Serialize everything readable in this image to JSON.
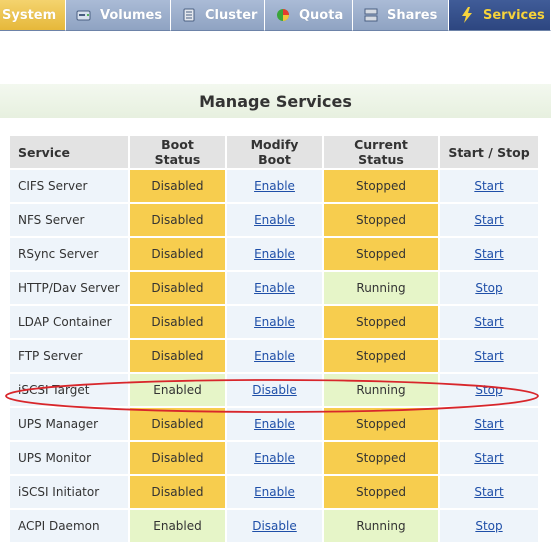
{
  "tabs": [
    {
      "label": "System",
      "icon": "system-icon"
    },
    {
      "label": "Volumes",
      "icon": "volumes-icon"
    },
    {
      "label": "Cluster",
      "icon": "cluster-icon"
    },
    {
      "label": "Quota",
      "icon": "quota-icon"
    },
    {
      "label": "Shares",
      "icon": "shares-icon"
    },
    {
      "label": "Services",
      "icon": "lightning-icon",
      "active": true
    }
  ],
  "page_title": "Manage Services",
  "table": {
    "headers": [
      "Service",
      "Boot Status",
      "Modify Boot",
      "Current Status",
      "Start / Stop"
    ],
    "rows": [
      {
        "service": "CIFS Server",
        "boot_status": "Disabled",
        "modify": "Enable",
        "current": "Stopped",
        "action": "Start"
      },
      {
        "service": "NFS Server",
        "boot_status": "Disabled",
        "modify": "Enable",
        "current": "Stopped",
        "action": "Start"
      },
      {
        "service": "RSync Server",
        "boot_status": "Disabled",
        "modify": "Enable",
        "current": "Stopped",
        "action": "Start"
      },
      {
        "service": "HTTP/Dav Server",
        "boot_status": "Disabled",
        "modify": "Enable",
        "current": "Running",
        "action": "Stop"
      },
      {
        "service": "LDAP Container",
        "boot_status": "Disabled",
        "modify": "Enable",
        "current": "Stopped",
        "action": "Start"
      },
      {
        "service": "FTP Server",
        "boot_status": "Disabled",
        "modify": "Enable",
        "current": "Stopped",
        "action": "Start"
      },
      {
        "service": "iSCSI Target",
        "boot_status": "Enabled",
        "modify": "Disable",
        "current": "Running",
        "action": "Stop",
        "highlighted": true
      },
      {
        "service": "UPS Manager",
        "boot_status": "Disabled",
        "modify": "Enable",
        "current": "Stopped",
        "action": "Start"
      },
      {
        "service": "UPS Monitor",
        "boot_status": "Disabled",
        "modify": "Enable",
        "current": "Stopped",
        "action": "Start"
      },
      {
        "service": "iSCSI Initiator",
        "boot_status": "Disabled",
        "modify": "Enable",
        "current": "Stopped",
        "action": "Start"
      },
      {
        "service": "ACPI Daemon",
        "boot_status": "Enabled",
        "modify": "Disable",
        "current": "Running",
        "action": "Stop"
      }
    ]
  },
  "colors": {
    "disabled_stopped": "#f7cd4e",
    "enabled_running": "#e6f5c8",
    "highlight_ring": "#d8262b",
    "active_tab": "#2d4680",
    "active_tab_text": "#f6d33c"
  }
}
